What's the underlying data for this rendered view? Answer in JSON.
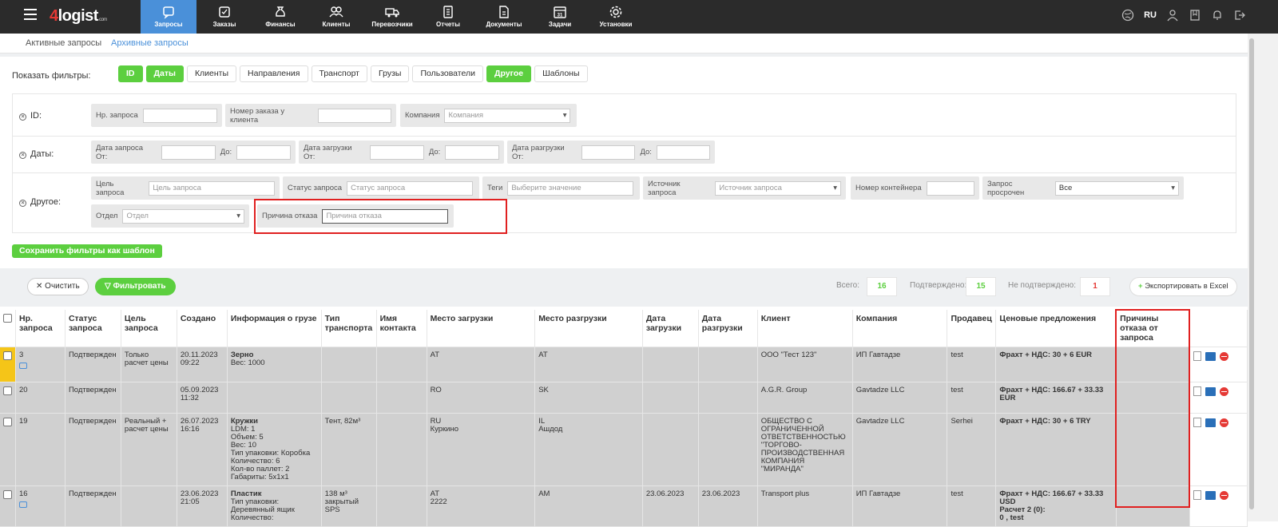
{
  "header": {
    "logo_brand": "logist",
    "logo_num": "4",
    "logo_suffix": "com",
    "nav": [
      {
        "label": "Запросы",
        "icon": "requests-icon",
        "active": true
      },
      {
        "label": "Заказы",
        "icon": "orders-icon"
      },
      {
        "label": "Финансы",
        "icon": "finance-icon"
      },
      {
        "label": "Клиенты",
        "icon": "clients-icon"
      },
      {
        "label": "Перевозчики",
        "icon": "truck-icon"
      },
      {
        "label": "Отчеты",
        "icon": "reports-icon"
      },
      {
        "label": "Документы",
        "icon": "documents-icon"
      },
      {
        "label": "Задачи",
        "icon": "calendar-icon"
      },
      {
        "label": "Установки",
        "icon": "gear-icon"
      }
    ],
    "lang": "RU"
  },
  "subnav": {
    "active_requests": "Активные запросы",
    "archive_requests": "Архивные запросы"
  },
  "filters": {
    "label": "Показать фильтры:",
    "buttons": [
      {
        "label": "ID",
        "on": true
      },
      {
        "label": "Даты",
        "on": true
      },
      {
        "label": "Клиенты"
      },
      {
        "label": "Направления"
      },
      {
        "label": "Транспорт"
      },
      {
        "label": "Грузы"
      },
      {
        "label": "Пользователи"
      },
      {
        "label": "Другое",
        "on": true
      },
      {
        "label": "Шаблоны"
      }
    ],
    "id_row": {
      "label": "ID:",
      "request_no": "Нр. запроса",
      "client_order_no": "Номер заказа у клиента",
      "company": "Компания",
      "company_placeholder": "Компания"
    },
    "dates_row": {
      "label": "Даты:",
      "request_from": "Дата запроса От:",
      "to1": "До:",
      "load_from": "Дата загрузки От:",
      "to2": "До:",
      "unload_from": "Дата разгрузки От:",
      "to3": "До:"
    },
    "other_row": {
      "label": "Другое:",
      "purpose": "Цель запроса",
      "purpose_placeholder": "Цель запроса",
      "status": "Статус запроса",
      "status_placeholder": "Статус запроса",
      "tags": "Теги",
      "tags_placeholder": "Выберите значение",
      "source": "Источник запроса",
      "source_placeholder": "Источник запроса",
      "container": "Номер контейнера",
      "overdue": "Запрос просрочен",
      "overdue_value": "Все",
      "dept": "Отдел",
      "dept_placeholder": "Отдел",
      "reason": "Причина отказа",
      "reason_placeholder": "Причина отказа"
    },
    "save_template": "Сохранить фильтры как шаблон"
  },
  "actions": {
    "clear": "Очистить",
    "filter": "Фильтровать",
    "total_label": "Всего:",
    "total": "16",
    "confirmed_label": "Подтверждено:",
    "confirmed": "15",
    "unconfirmed_label": "Не подтверждено:",
    "unconfirmed": "1",
    "export": "Экспортировать в Excel"
  },
  "table": {
    "headers": {
      "no": "Нр. запроса",
      "status": "Статус запроса",
      "purpose": "Цель запроса",
      "created": "Создано",
      "cargo": "Информация о грузе",
      "transport": "Тип транспорта",
      "contact": "Имя контакта",
      "load_place": "Место загрузки",
      "unload_place": "Место разгрузки",
      "load_date": "Дата загрузки",
      "unload_date": "Дата разгрузки",
      "client": "Клиент",
      "company": "Компания",
      "seller": "Продавец",
      "offers": "Ценовые предложения",
      "reasons": "Причины отказа от запроса"
    },
    "rows": [
      {
        "no": "3",
        "status": "Подтвержден",
        "purpose": "Только расчет цены",
        "created": "20.11.2023 09:22",
        "cargo_title": "Зерно",
        "cargo_details": "Вес: 1000",
        "transport": "",
        "contact": "",
        "load": "AT",
        "unload": "AT",
        "load_date": "",
        "unload_date": "",
        "client": "ООО \"Тест 123\"",
        "company": "ИП Гавтадзе",
        "seller": "test",
        "offer": "Фрахт + НДС: 30 + 6 EUR"
      },
      {
        "no": "20",
        "status": "Подтвержден",
        "purpose": "",
        "created": "05.09.2023 11:32",
        "cargo_title": "",
        "cargo_details": "",
        "transport": "",
        "contact": "",
        "load": "RO",
        "unload": "SK",
        "load_date": "",
        "unload_date": "",
        "client": "A.G.R. Group",
        "company": "Gavtadze LLC",
        "seller": "test",
        "offer": "Фрахт + НДС: 166.67 + 33.33 EUR"
      },
      {
        "no": "19",
        "status": "Подтвержден",
        "purpose": "Реальный + расчет цены",
        "created": "26.07.2023 16:16",
        "cargo_title": "Кружки",
        "cargo_details": "LDM: 1\nОбъем: 5\nВес: 10\nТип упаковки: Коробка\nКоличество: 6\nКол-во паллет: 2\nГабариты: 5x1x1",
        "transport": "Тент, 82м³",
        "contact": "",
        "load": "RU\nКуркино",
        "unload": "IL\nАшдод",
        "load_date": "",
        "unload_date": "",
        "client": "ОБЩЕСТВО С ОГРАНИЧЕННОЙ ОТВЕТСТВЕННОСТЬЮ \"ТОРГОВО-ПРОИЗВОДСТВЕННАЯ КОМПАНИЯ \"МИРАНДА\"",
        "company": "Gavtadze LLC",
        "seller": "Serhei",
        "offer": "Фрахт + НДС: 30 + 6 TRY"
      },
      {
        "no": "16",
        "status": "Подтвержден",
        "purpose": "",
        "created": "23.06.2023 21:05",
        "cargo_title": "Пластик",
        "cargo_details": "Тип упаковки:\nДеревянный ящик\nКоличество:",
        "transport": "138 м³\nзакрытый\nSPS",
        "contact": "",
        "load": "AT\n2222",
        "unload": "AM",
        "load_date": "23.06.2023",
        "unload_date": "23.06.2023",
        "client": "Transport plus",
        "company": "ИП Гавтадзе",
        "seller": "test",
        "offer": "Фрахт + НДС: 166.67 + 33.33 USD\nРасчет 2 (0):\n0 , test"
      }
    ]
  }
}
